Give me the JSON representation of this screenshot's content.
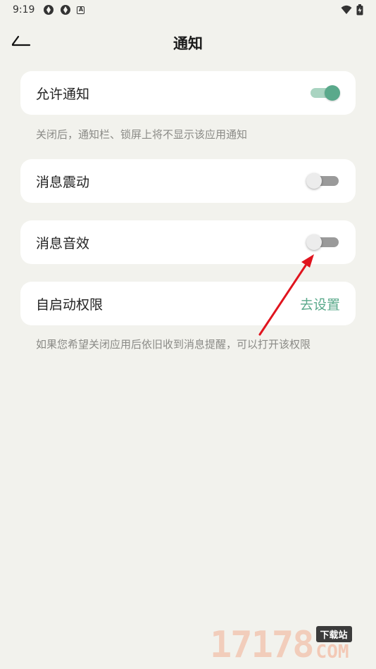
{
  "status_bar": {
    "time": "9:19",
    "left_icons": [
      "aperture-icon",
      "aperture-icon",
      "a-box-icon"
    ],
    "right_icons": [
      "wifi-icon",
      "battery-icon"
    ]
  },
  "header": {
    "title": "通知",
    "back_icon": "arrow-left-icon"
  },
  "settings": [
    {
      "label": "允许通知",
      "type": "switch",
      "on": true
    },
    {
      "label": "消息震动",
      "type": "switch",
      "on": false
    },
    {
      "label": "消息音效",
      "type": "switch",
      "on": false
    },
    {
      "label": "自启动权限",
      "type": "link",
      "action": "去设置"
    }
  ],
  "hints": {
    "allow_notifications": "关闭后，通知栏、锁屏上将不显示该应用通知",
    "autostart": "如果您希望关闭应用后依旧收到消息提醒，可以打开该权限"
  },
  "colors": {
    "accent": "#5aa98b",
    "background": "#f2f2ed",
    "annotation_arrow": "#e0141e"
  },
  "watermark": {
    "number": "17178",
    "badge": "下载站",
    "suffix": "COM"
  }
}
